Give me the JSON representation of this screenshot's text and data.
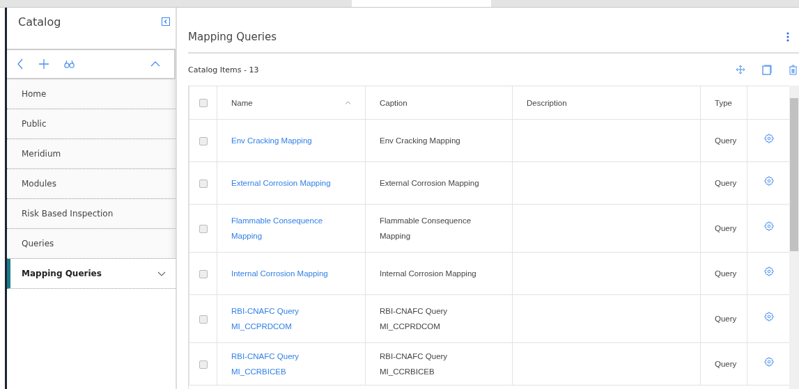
{
  "sidebar": {
    "title": "Catalog",
    "items": [
      {
        "label": "Home",
        "selected": false
      },
      {
        "label": "Public",
        "selected": false
      },
      {
        "label": "Meridium",
        "selected": false
      },
      {
        "label": "Modules",
        "selected": false
      },
      {
        "label": "Risk Based Inspection",
        "selected": false
      },
      {
        "label": "Queries",
        "selected": false
      },
      {
        "label": "Mapping Queries",
        "selected": true
      }
    ]
  },
  "main": {
    "title": "Mapping Queries",
    "count_label": "Catalog Items - 13",
    "table": {
      "select_all_checked": false,
      "columns": [
        "Name",
        "Caption",
        "Description",
        "Type"
      ],
      "rows": [
        {
          "checked": false,
          "name": "Env Cracking Mapping",
          "caption": "Env Cracking Mapping",
          "type": "Query"
        },
        {
          "checked": false,
          "name": "External Corrosion Mapping",
          "caption": "External Corrosion Mapping",
          "type": "Query"
        },
        {
          "checked": false,
          "name": "Flammable Consequence Mapping",
          "caption": "Flammable Consequence Mapping",
          "type": "Query"
        },
        {
          "checked": false,
          "name": "Internal Corrosion Mapping",
          "caption": "Internal Corrosion Mapping",
          "type": "Query"
        },
        {
          "checked": false,
          "name": "RBI-CNAFC Query MI_CCPRDCOM",
          "caption": "RBI-CNAFC Query MI_CCPRDCOM",
          "type": "Query"
        },
        {
          "checked": false,
          "name": "RBI-CNAFC Query MI_CCRBICEB",
          "caption": "RBI-CNAFC Query MI_CCRBICEB",
          "type": "Query"
        }
      ]
    }
  }
}
